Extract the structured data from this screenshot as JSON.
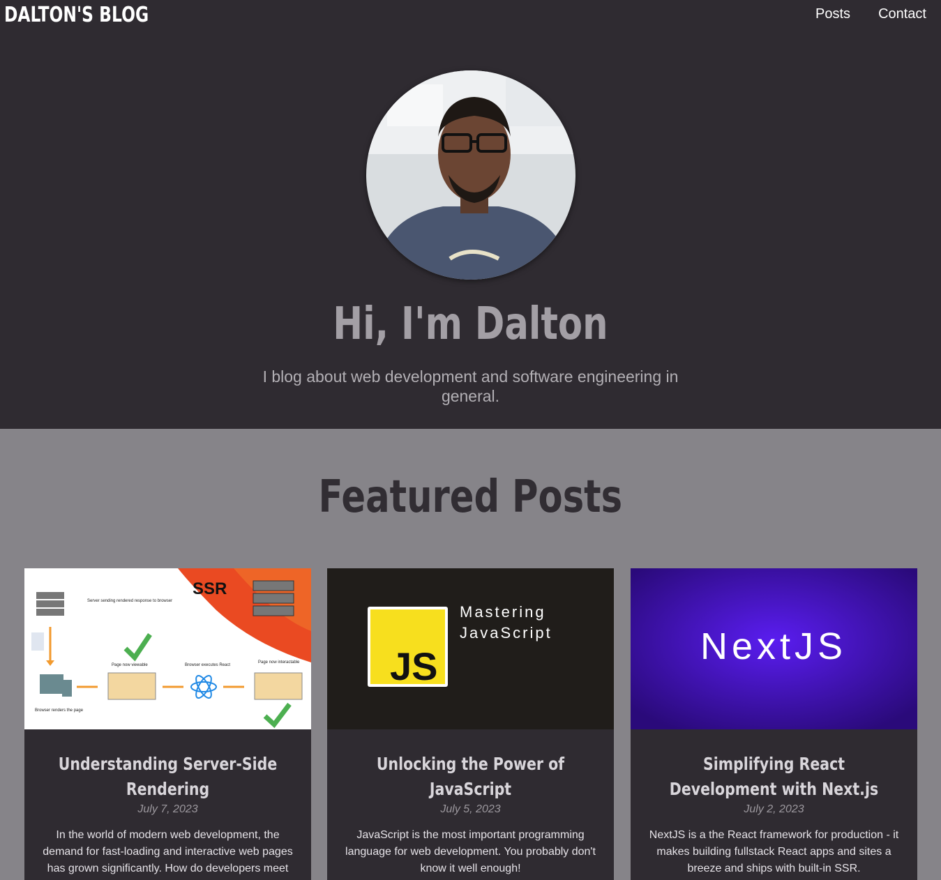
{
  "navbar": {
    "brand": "DALTON'S BLOG",
    "links": [
      {
        "label": "Posts"
      },
      {
        "label": "Contact"
      }
    ]
  },
  "hero": {
    "title": "Hi, I'm Dalton",
    "subtitle": "I blog about web development and software engineering in general."
  },
  "featured": {
    "title": "Featured Posts",
    "posts": [
      {
        "title": "Understanding Server-Side Rendering",
        "date": "July 7, 2023",
        "excerpt": "In the world of modern web development, the demand for fast-loading and interactive web pages has grown significantly. How do developers meet these expections?",
        "image_text": [
          "SSR",
          "Server sending rendered response to browser",
          "Page now viewable",
          "Browser executes React",
          "Page now interactable",
          "Browser renders the page"
        ]
      },
      {
        "title": "Unlocking the Power of JavaScript",
        "date": "July 5, 2023",
        "excerpt": "JavaScript is the most important programming language for web development. You probably don't know it well enough!",
        "image_text": [
          "JS",
          "Mastering",
          "JavaScript"
        ]
      },
      {
        "title": "Simplifying React Development with Next.js",
        "date": "July 2, 2023",
        "excerpt": "NextJS is a the React framework for production - it makes building fullstack React apps and sites a breeze and ships with built-in SSR.",
        "image_text": [
          "NextJS"
        ]
      }
    ]
  },
  "colors": {
    "dark_bg": "#2f2b31",
    "page_bg": "#868489",
    "accent_yellow": "#f7df1e",
    "next_purple": "#4a12c9"
  }
}
